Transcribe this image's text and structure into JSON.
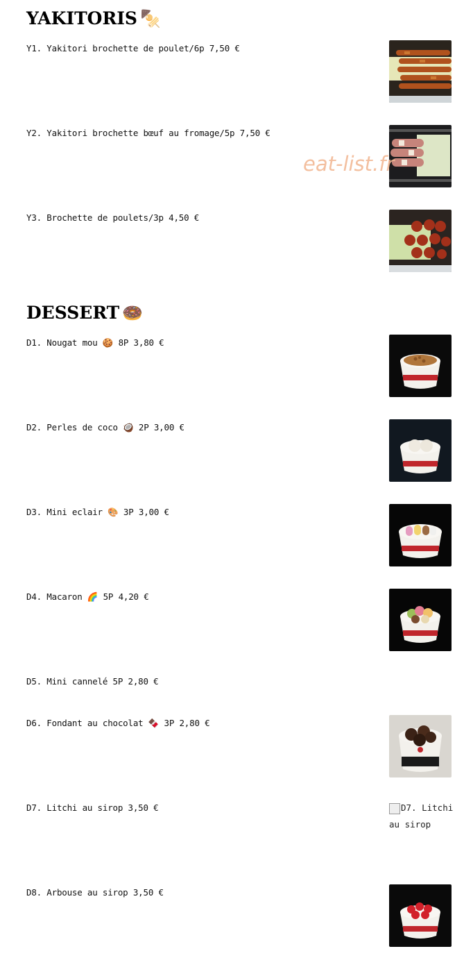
{
  "sections": {
    "yakitoris": {
      "title": "YAKITORIS",
      "emoji": "🍢"
    },
    "dessert": {
      "title": "DESSERT",
      "emoji": "🍩"
    }
  },
  "items": {
    "y1": "Y1. Yakitori brochette de poulet/6p 7,50 €",
    "y2": "Y2. Yakitori brochette bœuf au fromage/5p 7,50 €",
    "y3": "Y3. Brochette de poulets/3p 4,50 €",
    "d1": "D1. Nougat mou 🍪 8P 3,80 €",
    "d2": "D2. Perles de coco 🥥 2P 3,00 €",
    "d3": "D3. Mini eclair 🎨 3P 3,00 €",
    "d4": "D4. Macaron 🌈 5P 4,20 €",
    "d5": "D5. Mini cannelé 5P 2,80 €",
    "d6": "D6. Fondant au chocolat 🍫 3P 2,80 €",
    "d7": "D7. Litchi au sirop 3,50 €",
    "d8": "D8. Arbouse au sirop 3,50 €"
  },
  "broken_image_alt": "D7. Litchi au sirop",
  "watermark": "eat-list.fr"
}
